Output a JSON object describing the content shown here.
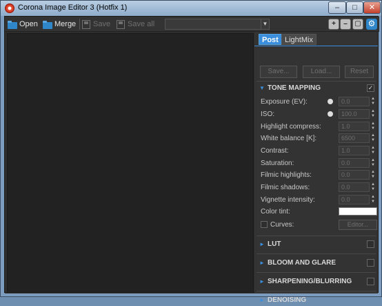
{
  "window": {
    "title": "Corona Image Editor 3 (Hotfix 1)",
    "minimize": "–",
    "maximize": "□",
    "close": "✕"
  },
  "toolbar": {
    "open_label": "Open",
    "merge_label": "Merge",
    "save_label": "Save",
    "save_all_label": "Save all",
    "dropdown_value": "",
    "zoom_in_icon": "+",
    "zoom_out_icon": "–",
    "zoom_fit_icon": "▢",
    "settings_icon": "⚙"
  },
  "tabs": [
    {
      "label": "Post",
      "active": true
    },
    {
      "label": "LightMix",
      "active": false
    }
  ],
  "presets": {
    "save": "Save...",
    "load": "Load...",
    "reset": "Reset"
  },
  "tone_mapping": {
    "title": "TONE MAPPING",
    "enabled": "✓",
    "fields": [
      {
        "label": "Exposure (EV):",
        "value": "0.0"
      },
      {
        "label": "ISO:",
        "value": "100.0"
      },
      {
        "label": "Highlight compress:",
        "value": "1.0"
      },
      {
        "label": "White balance [K]:",
        "value": "6500"
      },
      {
        "label": "Contrast:",
        "value": "1.0"
      },
      {
        "label": "Saturation:",
        "value": "0.0"
      },
      {
        "label": "Filmic highlights:",
        "value": "0.0"
      },
      {
        "label": "Filmic shadows:",
        "value": "0.0"
      },
      {
        "label": "Vignette intensity:",
        "value": "0.0"
      }
    ],
    "color_tint_label": "Color tint:",
    "color_tint_value": "#ffffff",
    "curves_label": "Curves:",
    "curves_editor": "Editor..."
  },
  "sections": [
    {
      "title": "LUT",
      "enabled": false
    },
    {
      "title": "BLOOM AND GLARE",
      "enabled": false
    },
    {
      "title": "SHARPENING/BLURRING",
      "enabled": false
    },
    {
      "title": "DENOISING",
      "enabled": false
    }
  ],
  "colors": {
    "accent": "#3a8edc",
    "panel_bg": "#333333",
    "viewport_bg": "#222222"
  }
}
